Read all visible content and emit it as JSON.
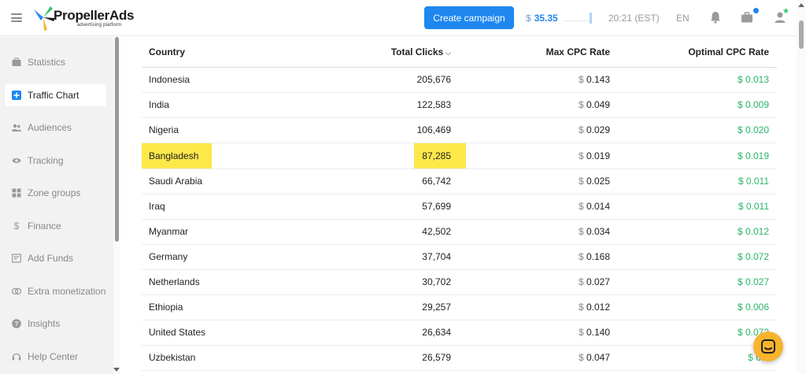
{
  "header": {
    "logo_text": "PropellerAds",
    "logo_sub": "advertising platform",
    "create_button": "Create campaign",
    "balance_currency": "$",
    "balance_amount": "35.35",
    "time": "20:21 (EST)",
    "language": "EN"
  },
  "sidebar": {
    "items": [
      {
        "label": "Statistics",
        "icon": "briefcase-icon"
      },
      {
        "label": "Traffic Chart",
        "icon": "plus-square-icon"
      },
      {
        "label": "Audiences",
        "icon": "people-icon"
      },
      {
        "label": "Tracking",
        "icon": "eye-icon"
      },
      {
        "label": "Zone groups",
        "icon": "grid-icon"
      },
      {
        "label": "Finance",
        "icon": "dollar-icon"
      },
      {
        "label": "Add Funds",
        "icon": "wallet-icon"
      },
      {
        "label": "Extra monetization",
        "icon": "coins-icon"
      },
      {
        "label": "Insights",
        "icon": "help-icon"
      },
      {
        "label": "Help Center",
        "icon": "headset-icon"
      }
    ]
  },
  "table": {
    "columns": [
      "Country",
      "Total Clicks",
      "Max CPC Rate",
      "Optimal CPC Rate"
    ],
    "currency": "$",
    "rows": [
      {
        "country": "Indonesia",
        "clicks": "205,676",
        "max": "0.143",
        "opt": "0.013"
      },
      {
        "country": "India",
        "clicks": "122,583",
        "max": "0.049",
        "opt": "0.009"
      },
      {
        "country": "Nigeria",
        "clicks": "106,469",
        "max": "0.029",
        "opt": "0.020"
      },
      {
        "country": "Bangladesh",
        "clicks": "87,285",
        "max": "0.019",
        "opt": "0.019"
      },
      {
        "country": "Saudi Arabia",
        "clicks": "66,742",
        "max": "0.025",
        "opt": "0.011"
      },
      {
        "country": "Iraq",
        "clicks": "57,699",
        "max": "0.014",
        "opt": "0.011"
      },
      {
        "country": "Myanmar",
        "clicks": "42,502",
        "max": "0.034",
        "opt": "0.012"
      },
      {
        "country": "Germany",
        "clicks": "37,704",
        "max": "0.168",
        "opt": "0.072"
      },
      {
        "country": "Netherlands",
        "clicks": "30,702",
        "max": "0.027",
        "opt": "0.027"
      },
      {
        "country": "Ethiopia",
        "clicks": "29,257",
        "max": "0.012",
        "opt": "0.006"
      },
      {
        "country": "United States",
        "clicks": "26,634",
        "max": "0.140",
        "opt": "0.072"
      },
      {
        "country": "Uzbekistan",
        "clicks": "26,579",
        "max": "0.047",
        "opt": "0.0"
      }
    ]
  },
  "colors": {
    "accent": "#1e87f0",
    "positive": "#2bb36a",
    "highlight": "#fde84a",
    "chat": "#f7b42c"
  }
}
